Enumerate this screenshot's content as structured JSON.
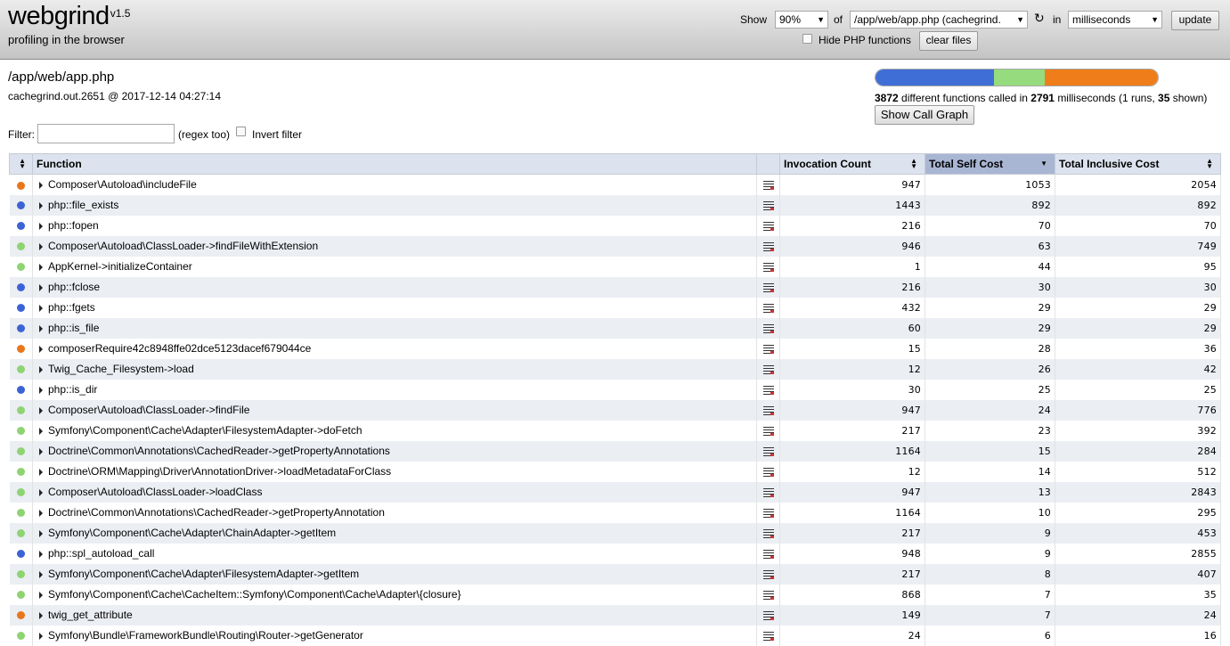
{
  "header": {
    "logo": "webgrind",
    "version": "v1.5",
    "tagline": "profiling in the browser",
    "show_label": "Show",
    "percent": "90%",
    "of_label": "of",
    "file_select": "/app/web/app.php (cachegrind.",
    "in_label": "in",
    "unit_select": "milliseconds",
    "update_button": "update",
    "hide_php_label": "Hide PHP functions",
    "clear_files_button": "clear files"
  },
  "info": {
    "file_path": "/app/web/app.php",
    "file_meta": "cachegrind.out.2651 @ 2017-12-14 04:27:14",
    "functions_count": "3872",
    "functions_text": "different functions called in",
    "total_ms": "2791",
    "ms_text": "milliseconds (1 runs,",
    "shown_count": "35",
    "shown_text": "shown)",
    "call_graph_button": "Show Call Graph",
    "bar_colors": [
      "#3f6fd6",
      "#96db7e",
      "#ef7d1a"
    ],
    "bar_fractions": [
      0.42,
      0.18,
      0.4
    ]
  },
  "filter": {
    "label": "Filter:",
    "value": "",
    "regex_label": "(regex too)",
    "invert_label": "Invert filter"
  },
  "table": {
    "headers": {
      "function": "Function",
      "invocation": "Invocation Count",
      "self": "Total Self Cost",
      "inclusive": "Total Inclusive Cost"
    },
    "dot_colors": {
      "blue": "#3c63d6",
      "green": "#8ed472",
      "orange": "#e8771b"
    },
    "rows": [
      {
        "dot": "orange",
        "fn": "Composer\\Autoload\\includeFile",
        "inv": "947",
        "self": "1053",
        "incl": "2054"
      },
      {
        "dot": "blue",
        "fn": "php::file_exists",
        "inv": "1443",
        "self": "892",
        "incl": "892"
      },
      {
        "dot": "blue",
        "fn": "php::fopen",
        "inv": "216",
        "self": "70",
        "incl": "70"
      },
      {
        "dot": "green",
        "fn": "Composer\\Autoload\\ClassLoader->findFileWithExtension",
        "inv": "946",
        "self": "63",
        "incl": "749"
      },
      {
        "dot": "green",
        "fn": "AppKernel->initializeContainer",
        "inv": "1",
        "self": "44",
        "incl": "95"
      },
      {
        "dot": "blue",
        "fn": "php::fclose",
        "inv": "216",
        "self": "30",
        "incl": "30"
      },
      {
        "dot": "blue",
        "fn": "php::fgets",
        "inv": "432",
        "self": "29",
        "incl": "29"
      },
      {
        "dot": "blue",
        "fn": "php::is_file",
        "inv": "60",
        "self": "29",
        "incl": "29"
      },
      {
        "dot": "orange",
        "fn": "composerRequire42c8948ffe02dce5123dacef679044ce",
        "inv": "15",
        "self": "28",
        "incl": "36"
      },
      {
        "dot": "green",
        "fn": "Twig_Cache_Filesystem->load",
        "inv": "12",
        "self": "26",
        "incl": "42"
      },
      {
        "dot": "blue",
        "fn": "php::is_dir",
        "inv": "30",
        "self": "25",
        "incl": "25"
      },
      {
        "dot": "green",
        "fn": "Composer\\Autoload\\ClassLoader->findFile",
        "inv": "947",
        "self": "24",
        "incl": "776"
      },
      {
        "dot": "green",
        "fn": "Symfony\\Component\\Cache\\Adapter\\FilesystemAdapter->doFetch",
        "inv": "217",
        "self": "23",
        "incl": "392"
      },
      {
        "dot": "green",
        "fn": "Doctrine\\Common\\Annotations\\CachedReader->getPropertyAnnotations",
        "inv": "1164",
        "self": "15",
        "incl": "284"
      },
      {
        "dot": "green",
        "fn": "Doctrine\\ORM\\Mapping\\Driver\\AnnotationDriver->loadMetadataForClass",
        "inv": "12",
        "self": "14",
        "incl": "512"
      },
      {
        "dot": "green",
        "fn": "Composer\\Autoload\\ClassLoader->loadClass",
        "inv": "947",
        "self": "13",
        "incl": "2843"
      },
      {
        "dot": "green",
        "fn": "Doctrine\\Common\\Annotations\\CachedReader->getPropertyAnnotation",
        "inv": "1164",
        "self": "10",
        "incl": "295"
      },
      {
        "dot": "green",
        "fn": "Symfony\\Component\\Cache\\Adapter\\ChainAdapter->getItem",
        "inv": "217",
        "self": "9",
        "incl": "453"
      },
      {
        "dot": "blue",
        "fn": "php::spl_autoload_call",
        "inv": "948",
        "self": "9",
        "incl": "2855"
      },
      {
        "dot": "green",
        "fn": "Symfony\\Component\\Cache\\Adapter\\FilesystemAdapter->getItem",
        "inv": "217",
        "self": "8",
        "incl": "407"
      },
      {
        "dot": "green",
        "fn": "Symfony\\Component\\Cache\\CacheItem::Symfony\\Component\\Cache\\Adapter\\{closure}",
        "inv": "868",
        "self": "7",
        "incl": "35"
      },
      {
        "dot": "orange",
        "fn": "twig_get_attribute",
        "inv": "149",
        "self": "7",
        "incl": "24"
      },
      {
        "dot": "green",
        "fn": "Symfony\\Bundle\\FrameworkBundle\\Routing\\Router->getGenerator",
        "inv": "24",
        "self": "6",
        "incl": "16"
      }
    ]
  }
}
